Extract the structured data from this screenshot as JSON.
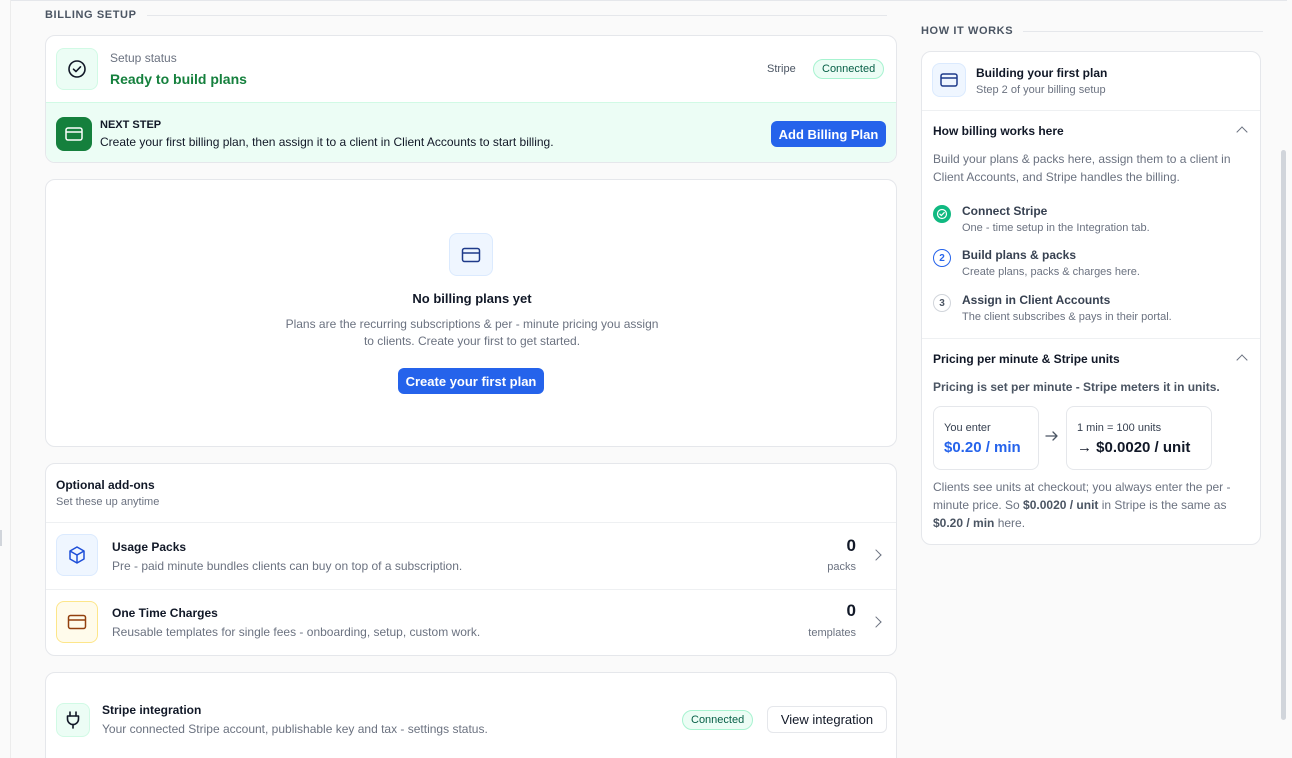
{
  "billing_setup": {
    "section_title": "BILLING SETUP",
    "status_label": "Setup status",
    "status_value": "Ready to build plans",
    "provider": "Stripe",
    "provider_badge": "Connected",
    "next_step": {
      "label": "NEXT STEP",
      "text": "Create your first billing plan, then assign it to a client in Client Accounts to start billing.",
      "button": "Add Billing Plan"
    }
  },
  "empty_state": {
    "title": "No billing plans yet",
    "line1": "Plans are the recurring subscriptions & per - minute pricing you assign",
    "line2": "to clients. Create your first to get started.",
    "button": "Create your first plan"
  },
  "addons": {
    "title": "Optional add-ons",
    "subtitle": "Set these up anytime",
    "items": [
      {
        "title": "Usage Packs",
        "desc": "Pre - paid minute bundles clients can buy on top of a subscription.",
        "count": "0",
        "unit": "packs"
      },
      {
        "title": "One Time Charges",
        "desc": "Reusable templates for single fees - onboarding, setup, custom work.",
        "count": "0",
        "unit": "templates"
      }
    ]
  },
  "stripe_integration": {
    "title": "Stripe integration",
    "desc": "Your connected Stripe account, publishable key and tax - settings status.",
    "badge": "Connected",
    "button": "View integration"
  },
  "how_it_works": {
    "section_title": "HOW IT WORKS",
    "header_title": "Building your first plan",
    "header_sub": "Step 2 of your billing setup",
    "billing": {
      "title": "How billing works here",
      "intro_line1": "Build your plans & packs here, assign them to a client in",
      "intro_line2": "Client Accounts, and Stripe handles the billing.",
      "steps": [
        {
          "num": "",
          "title": "Connect Stripe",
          "desc": "One - time setup in the Integration tab."
        },
        {
          "num": "2",
          "title": "Build plans & packs",
          "desc": "Create plans, packs & charges here."
        },
        {
          "num": "3",
          "title": "Assign in Client Accounts",
          "desc": "The client subscribes & pays in their portal."
        }
      ]
    },
    "pricing": {
      "title": "Pricing per minute & Stripe units",
      "subtitle": "Pricing is set per minute - Stripe meters it in units.",
      "you_enter_label": "You enter",
      "you_enter_value": "$0.20 / min",
      "conversion_label": "1 min = 100 units",
      "conversion_value": "→ $0.0020 / unit",
      "note_line1": "Clients see units at checkout; you always enter the per -",
      "note_line2_a": "minute price. So ",
      "note_line2_b": "$0.0020 / unit",
      "note_line2_c": " in Stripe is the same as",
      "note_line3_a": "$0.20 / min",
      "note_line3_b": " here."
    }
  },
  "colors": {
    "accent": "#2563eb",
    "success": "#15803d",
    "next_step_bg": "#ecfdf5"
  }
}
